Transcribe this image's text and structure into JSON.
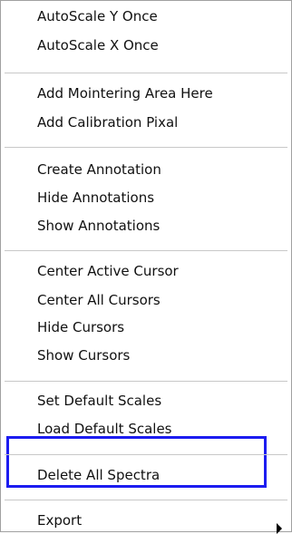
{
  "menu": {
    "items": [
      "AutoScale Y Once",
      "AutoScale X Once",
      "Add Mointering Area Here",
      "Add Calibration Pixal",
      "Create Annotation",
      "Hide Annotations",
      "Show Annotations",
      "Center Active Cursor",
      "Center All Cursors",
      "Hide Cursors",
      "Show Cursors",
      "Set Default Scales",
      "Load Default Scales",
      "Delete All Spectra",
      "Export"
    ],
    "highlight_color": "#1c1cf0",
    "submenu_icon": "submenu-arrow-icon"
  }
}
